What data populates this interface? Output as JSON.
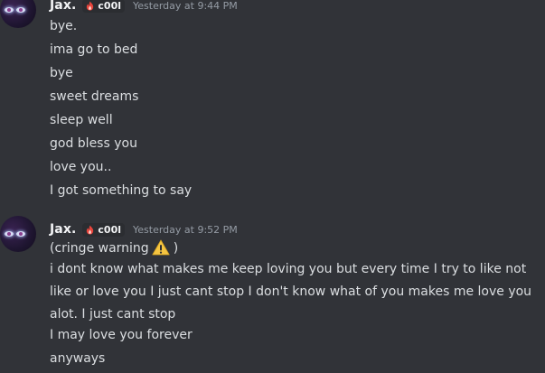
{
  "groups": [
    {
      "username": "Jax.",
      "tag": "c00l",
      "timestamp": "Yesterday at 9:44 PM",
      "lines": [
        "bye.",
        "ima go to bed",
        "bye",
        "sweet dreams",
        "sleep well",
        "god bless you",
        "love you..",
        "I got something to say"
      ]
    },
    {
      "username": "Jax.",
      "tag": "c00l",
      "timestamp": "Yesterday at 9:52 PM",
      "lines": [
        "(cringe warning",
        ")",
        "i dont know what makes me keep loving you but every time I try to like not like or love you I just cant stop I don't know what of you makes me love you alot. I just cant stop",
        "I may love you forever",
        "anyways"
      ]
    }
  ],
  "icons": {
    "avatar": "avatar-glowing-eyes",
    "tag": "flame-icon",
    "warning": "warning-icon"
  },
  "colors": {
    "background": "#313338",
    "username": "#f2f3f5",
    "text": "#dbdee1",
    "timestamp": "#949ba4",
    "tag_bg": "#2b2d31",
    "flame": "#e8453c",
    "warning": "#f5c542"
  }
}
